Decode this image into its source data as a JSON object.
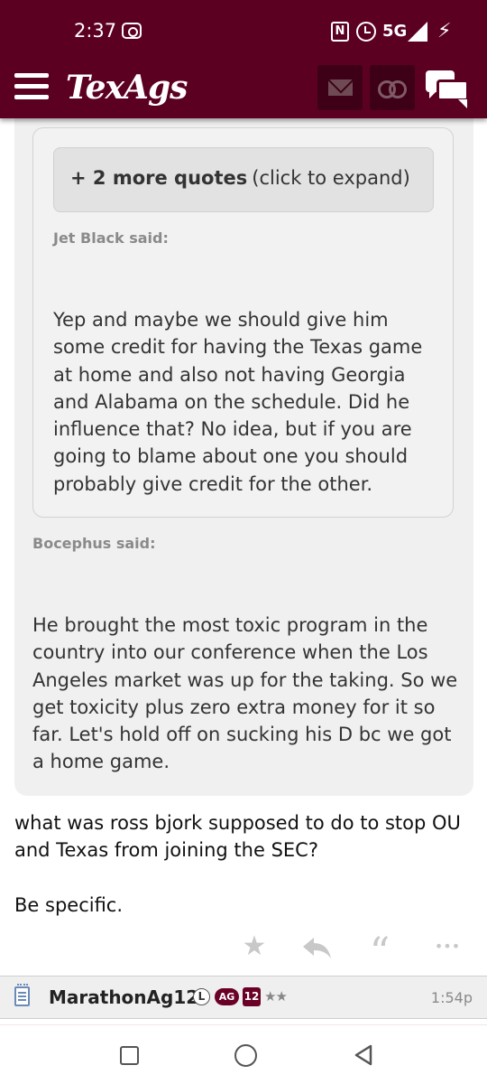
{
  "status_bar": {
    "time": "2:37",
    "network": "5G",
    "nfc_label": "N"
  },
  "app_bar": {
    "logo_text": "TexAgs",
    "icons": [
      "hamburger-menu-icon",
      "mail-icon",
      "binoculars-icon",
      "chat-bubbles-icon"
    ],
    "brand_color": "#5c0022"
  },
  "quote_expand": {
    "bold_label": "+ 2 more quotes",
    "hint": "(click to expand)"
  },
  "quotes": [
    {
      "author_line": "Jet Black said:",
      "text": "Yep and maybe we should give him some credit for having the Texas game at home and also not having Georgia and Alabama on the schedule. Did he influence that? No idea, but if you are going to blame about one you should probably give credit for the other."
    },
    {
      "author_line": "Bocephus said:",
      "text": "He brought the most toxic program in the country into our conference when the Los Angeles market was up for the taking. So we get toxicity plus zero extra money for it so far. Let's hold off on sucking his D bc we got a home game."
    }
  ],
  "post": {
    "paragraph_1": "what was ross bjork supposed to do to stop OU and Texas from joining the SEC?",
    "paragraph_2": "Be specific."
  },
  "post_actions": {
    "icons": [
      "star-icon",
      "reply-icon",
      "quote-icon",
      "more-icon"
    ],
    "star_glyph": "★",
    "reply_glyph": "↶",
    "quote_glyph": "“",
    "more_glyph": "•••"
  },
  "next_post": {
    "username": "MarathonAg12",
    "badge_l": "L",
    "badge_ag": "AG",
    "badge_year": "12",
    "stars": "★★",
    "time": "1:54p"
  },
  "nav_bar": {
    "icons": [
      "recents-square-icon",
      "home-circle-icon",
      "back-triangle-icon"
    ]
  }
}
